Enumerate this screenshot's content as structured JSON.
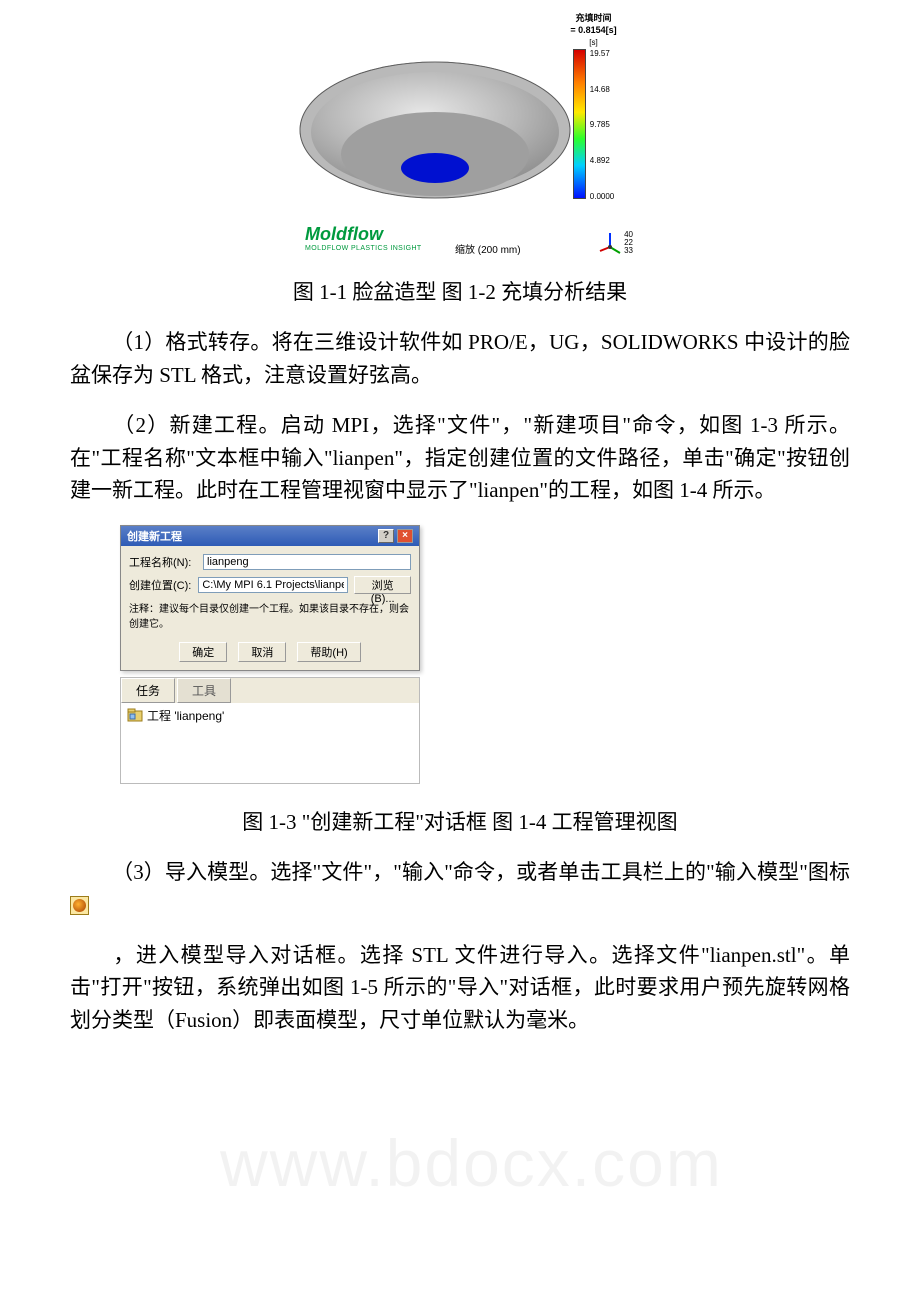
{
  "figure1": {
    "moldflow": "Moldflow",
    "moldflow_sub": "MOLDFLOW PLASTICS INSIGHT",
    "scale_label": "缩放 (200 mm)",
    "legend_title_l1": "充填时间",
    "legend_title_l2": "= 0.8154[s]",
    "legend_unit": "[s]",
    "ticks": [
      "19.57",
      "14.68",
      "9.785",
      "4.892",
      "0.0000"
    ],
    "triad_nums": [
      "40",
      "22",
      "33"
    ]
  },
  "chart_data": {
    "type": "heatmap",
    "title": "充填时间 = 0.8154[s]",
    "ylabel": "[s]",
    "values_range": [
      0.0,
      19.57
    ],
    "colorbar_ticks": [
      19.57,
      14.68,
      9.785,
      4.892,
      0.0
    ],
    "orientation_angles": [
      40,
      22,
      33
    ],
    "scale_hint": "缩放 (200 mm)"
  },
  "caption1": "图 1-1 脸盆造型 图 1-2 充填分析结果",
  "para1": "（1）格式转存。将在三维设计软件如 PRO/E，UG，SOLIDWORKS 中设计的脸盆保存为 STL 格式，注意设置好弦高。",
  "para2": "（2）新建工程。启动 MPI，选择\"文件\"，\"新建项目\"命令，如图 1-3 所示。在\"工程名称\"文本框中输入\"lianpen\"，指定创建位置的文件路径，单击\"确定\"按钮创建一新工程。此时在工程管理视窗中显示了\"lianpen\"的工程，如图 1-4 所示。",
  "dialog": {
    "title": "创建新工程",
    "label_name": "工程名称(N):",
    "value_name": "lianpeng",
    "label_loc": "创建位置(C):",
    "value_loc": "C:\\My MPI 6.1 Projects\\lianpe",
    "browse": "浏览(B)...",
    "note": "注释：建议每个目录仅创建一个工程。如果该目录不存在，则会创建它。",
    "btn_ok": "确定",
    "btn_cancel": "取消",
    "btn_help": "帮助(H)"
  },
  "panel": {
    "tab_task": "任务",
    "tab_tool": "工具",
    "project_label": "工程 'lianpeng'"
  },
  "caption2": "图 1-3 \"创建新工程\"对话框 图 1-4 工程管理视图",
  "para3_a": "（3）导入模型。选择\"文件\"，\"输入\"命令，或者单击工具栏上的\"输入模型\"图标",
  "para4": "，进入模型导入对话框。选择 STL 文件进行导入。选择文件\"lianpen.stl\"。单击\"打开\"按钮，系统弹出如图 1-5 所示的\"导入\"对话框，此时要求用户预先旋转网格划分类型（Fusion）即表面模型，尺寸单位默认为毫米。",
  "watermark": "www.bdocx.com"
}
